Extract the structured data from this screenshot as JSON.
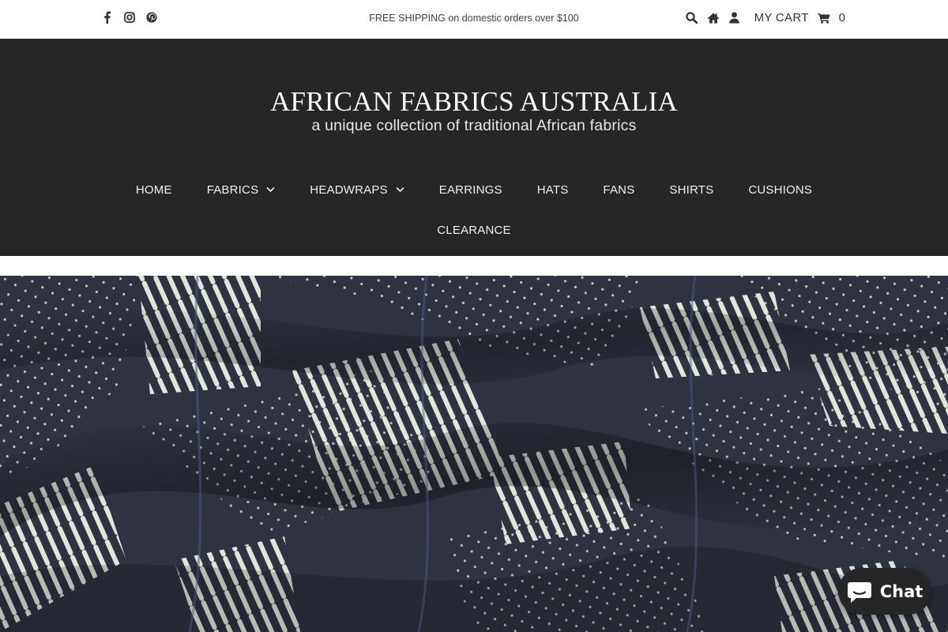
{
  "topbar": {
    "social": [
      {
        "name": "facebook-icon"
      },
      {
        "name": "instagram-icon"
      },
      {
        "name": "pinterest-icon"
      }
    ],
    "promo": "FREE SHIPPING on domestic orders over $100",
    "cart_label": "MY CART",
    "cart_count": "0"
  },
  "header": {
    "title": "AFRICAN FABRICS AUSTRALIA",
    "tagline": "a unique collection of traditional African fabrics"
  },
  "nav": {
    "items": [
      {
        "label": "HOME",
        "dropdown": false
      },
      {
        "label": "FABRICS",
        "dropdown": true
      },
      {
        "label": "HEADWRAPS",
        "dropdown": true
      },
      {
        "label": "EARRINGS",
        "dropdown": false
      },
      {
        "label": "HATS",
        "dropdown": false
      },
      {
        "label": "FANS",
        "dropdown": false
      },
      {
        "label": "SHIRTS",
        "dropdown": false
      },
      {
        "label": "CUSHIONS",
        "dropdown": false
      }
    ],
    "second_row": "CLEARANCE"
  },
  "chat": {
    "label": "Chat"
  },
  "colors": {
    "header_bg": "#262626",
    "hero_fabric": "#2f3340",
    "fabric_print": "#dfe6dc"
  }
}
